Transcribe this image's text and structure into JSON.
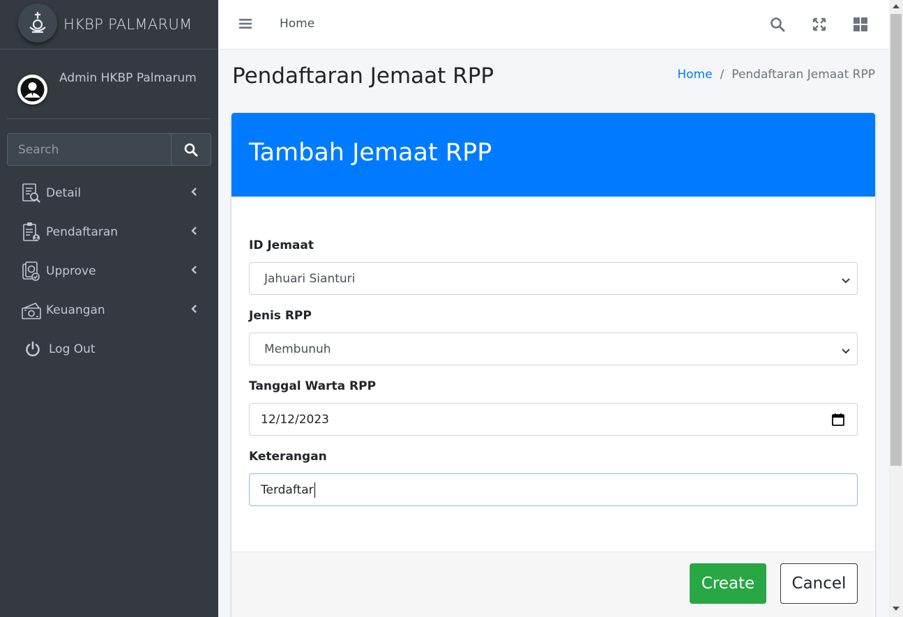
{
  "brand": {
    "name": "HKBP PALMARUM",
    "logo_icon": "church-logo-icon"
  },
  "user": {
    "name": "Admin HKBP Palmarum",
    "avatar_icon": "user-avatar-icon"
  },
  "sidebar": {
    "search_placeholder": "Search",
    "items": [
      {
        "label": "Detail",
        "icon": "document-search-icon",
        "has_submenu": true
      },
      {
        "label": "Pendaftaran",
        "icon": "clipboard-user-icon",
        "has_submenu": true
      },
      {
        "label": "Upprove",
        "icon": "approve-stamp-icon",
        "has_submenu": true
      },
      {
        "label": "Keuangan",
        "icon": "money-icon",
        "has_submenu": true
      },
      {
        "label": "Log Out",
        "icon": "power-icon",
        "has_submenu": false
      }
    ]
  },
  "topbar": {
    "home_label": "Home"
  },
  "page": {
    "title": "Pendaftaran Jemaat RPP",
    "breadcrumb": [
      "Home",
      "Pendaftaran Jemaat RPP"
    ]
  },
  "card": {
    "title": "Tambah Jemaat RPP",
    "fields": [
      {
        "label": "ID Jemaat",
        "type": "select",
        "value": "Jahuari Sianturi"
      },
      {
        "label": "Jenis RPP",
        "type": "select",
        "value": "Membunuh"
      },
      {
        "label": "Tanggal Warta RPP",
        "type": "date",
        "value": "12/12/2023"
      },
      {
        "label": "Keterangan",
        "type": "text",
        "value": "Terdaftar"
      }
    ],
    "create_label": "Create",
    "cancel_label": "Cancel"
  },
  "colors": {
    "primary": "#007bff",
    "success": "#28a745",
    "sidebar": "#343a40"
  }
}
